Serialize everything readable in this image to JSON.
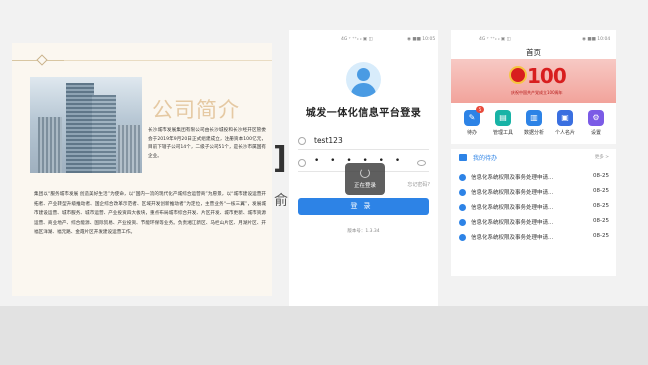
{
  "colors": {
    "accent": "#2d83e6",
    "banner_red": "#d81e1e",
    "profile_title": "#e5c9a3"
  },
  "profile": {
    "title": "公司简介",
    "para1": "长沙城市发展集团有限公司由长沙城投和长沙经开区管委会于2019年9月20日正式组建成立，注册资本100亿元，目前下辖子公司14个，二级子公司51个，是长沙市属国有企业。",
    "para2": "集团以“服务城市发展 创造美好生活”为使命，以“国内一流的现代化产城综合运营商”为愿景，以“城市建设运营开拓者、产业转型升级推动者、国企综合改革示范者、区域开发创新推动者”为定位，主营业务“一核三翼”，发展城市建设运营、城市服务、城市运营、产业投资四大板块，重点布局城市综合开发、片区开发、城市更新、城市资源运营、商业地产、综合能源、国际贸易、产业投资、节能环保等业务。负责湘江新区、马栏山片区、月湖片区、开福区洋湖、福元路、金霞片区开发建设运营工作。"
  },
  "bg_overlay": {
    "bracket": "]",
    "char": "俞"
  },
  "login": {
    "status_left": "4G ᵛ ⁺⁺ᵢₗ ᵢₗ ▣ ◫",
    "status_right": "◉ ■■ 10:05",
    "title": "城发一体化信息平台登录",
    "username": "test123",
    "password_mask": "• • • • • •",
    "loading_text": "正在登录",
    "forgot": "忘记密码?",
    "submit": "登录",
    "version": "版本号：1.3.34"
  },
  "home": {
    "status_left": "4G ᵛ ⁺⁺ᵢₗ ᵢₗ ▣ ◫",
    "status_right": "◉ ■■ 10:04",
    "title": "首页",
    "banner_number": "100",
    "banner_sub": "庆祝中国共产党成立100周年",
    "quick_items": [
      {
        "label": "待办",
        "icon": "todo-icon",
        "color": "#2d83e6",
        "glyph": "✎",
        "badge": "5"
      },
      {
        "label": "管理工具",
        "icon": "toolbox-icon",
        "color": "#18b3a6",
        "glyph": "▤"
      },
      {
        "label": "数据分析",
        "icon": "chart-icon",
        "color": "#2d83e6",
        "glyph": "▥"
      },
      {
        "label": "个人名片",
        "icon": "id-card-icon",
        "color": "#3a6fe0",
        "glyph": "▣"
      },
      {
        "label": "设置",
        "icon": "gear-icon",
        "color": "#7b5be6",
        "glyph": "⚙"
      }
    ],
    "todo_title": "我的待办",
    "todo_more": "更多 >",
    "todo_rows": [
      {
        "text": "信息化系统权限及事务处理申请...",
        "date": "08-25"
      },
      {
        "text": "信息化系统权限及事务处理申请...",
        "date": "08-25"
      },
      {
        "text": "信息化系统权限及事务处理申请...",
        "date": "08-25"
      },
      {
        "text": "信息化系统权限及事务处理申请...",
        "date": "08-25"
      },
      {
        "text": "信息化系统权限及事务处理申请...",
        "date": "08-25"
      }
    ]
  }
}
